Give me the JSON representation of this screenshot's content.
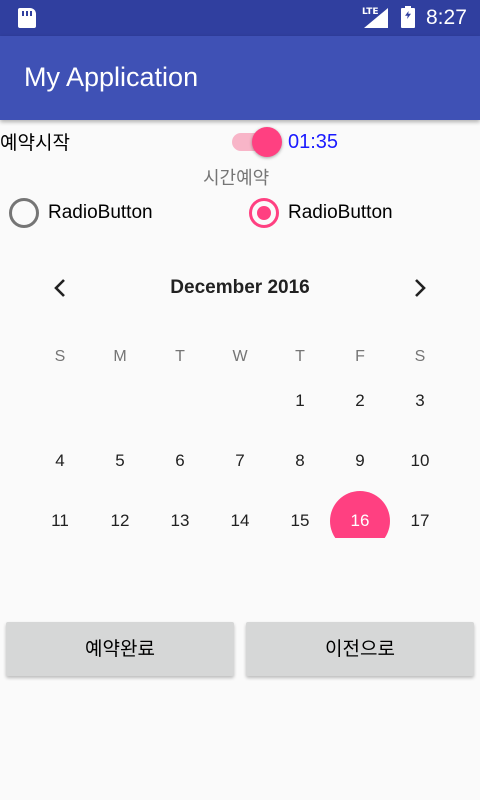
{
  "status_bar": {
    "network_label": "LTE",
    "time": "8:27",
    "icons": [
      "sd-card-icon",
      "signal-icon",
      "battery-charging-icon"
    ]
  },
  "app_bar": {
    "title": "My Application"
  },
  "reservation": {
    "start_label": "예약시작",
    "switch_on": true,
    "time_value": "01:35",
    "time_reserve_label": "시간예약"
  },
  "radios": [
    {
      "label": "RadioButton",
      "checked": false
    },
    {
      "label": "RadioButton",
      "checked": true
    }
  ],
  "calendar": {
    "month_label": "December 2016",
    "weekdays": [
      "S",
      "M",
      "T",
      "W",
      "T",
      "F",
      "S"
    ],
    "first_weekday_index": 4,
    "visible_days": [
      1,
      2,
      3,
      4,
      5,
      6,
      7,
      8,
      9,
      10,
      11,
      12,
      13,
      14,
      15,
      16,
      17
    ],
    "selected_day": 16,
    "accent_color": "#ff4081"
  },
  "buttons": {
    "done_label": "예약완료",
    "back_label": "이전으로"
  },
  "colors": {
    "primary_dark": "#303f9f",
    "primary": "#3f51b5",
    "accent": "#ff4081",
    "time_text": "#1a1aff"
  }
}
